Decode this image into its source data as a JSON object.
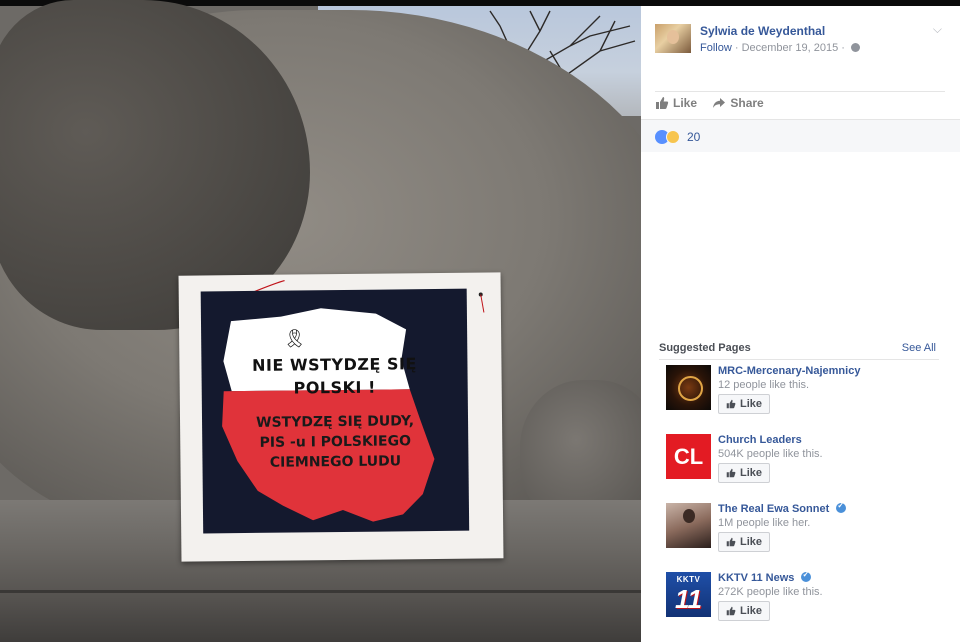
{
  "post": {
    "author": "Sylwia de Weydenthal",
    "follow": "Follow",
    "date": "December 19, 2015",
    "actions": {
      "like": "Like",
      "share": "Share"
    },
    "reaction_count": "20"
  },
  "photo": {
    "sign_line1": "NIE WSTYDZĘ SIĘ",
    "sign_line2": "POLSKI !",
    "sign_red_1": "WSTYDZĘ SIĘ DUDY,",
    "sign_red_2": "PIS -u I POLSKIEGO",
    "sign_red_3": "CIEMNEGO LUDU"
  },
  "suggested": {
    "title": "Suggested Pages",
    "see_all": "See All",
    "like_label": "Like",
    "pages": [
      {
        "name": "MRC-Mercenary-Najemnicy",
        "likes": "12 people like this.",
        "verified": false
      },
      {
        "name": "Church Leaders",
        "likes": "504K people like this.",
        "verified": false,
        "thumb_text": "CL"
      },
      {
        "name": "The Real Ewa Sonnet",
        "likes": "1M people like her.",
        "verified": true
      },
      {
        "name": "KKTV 11 News",
        "likes": "272K people like this.",
        "verified": true,
        "thumb_top": "KKTV",
        "thumb_num": "11"
      }
    ]
  },
  "colors": {
    "link": "#365899",
    "meta": "#90949c",
    "like_reaction": "#5890ff",
    "sign_red": "#e0333a"
  }
}
